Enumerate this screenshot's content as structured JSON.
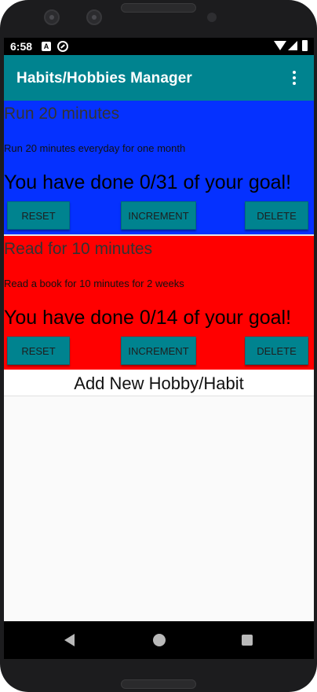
{
  "status_bar": {
    "time": "6:58",
    "notification_icon_letter": "A",
    "icons": [
      "a-notification-icon",
      "sync-icon",
      "wifi-icon",
      "signal-icon",
      "battery-icon"
    ]
  },
  "app_bar": {
    "title": "Habits/Hobbies Manager",
    "background_color": "#00838f",
    "overflow_icon": "more-vert-icon"
  },
  "habits": [
    {
      "title": "Run 20 minutes",
      "description": "Run 20 minutes everyday for one month",
      "progress_text": "You have done 0/31 of your goal!",
      "done": 0,
      "goal": 31,
      "background_color": "#0531ff",
      "reset_label": "RESET",
      "increment_label": "INCREMENT",
      "delete_label": "DELETE"
    },
    {
      "title": "Read for 10 minutes",
      "description": "Read a book for 10 minutes for 2 weeks",
      "progress_text": "You have done 0/14 of your goal!",
      "done": 0,
      "goal": 14,
      "background_color": "#ff0000",
      "reset_label": "RESET",
      "increment_label": "INCREMENT",
      "delete_label": "DELETE"
    }
  ],
  "add_habit": {
    "label": "Add New Hobby/Habit"
  },
  "nav_bar": {
    "icons": [
      "back-icon",
      "home-icon",
      "recents-icon"
    ]
  },
  "colors": {
    "button": "#00838f",
    "accent": "#00838f"
  }
}
